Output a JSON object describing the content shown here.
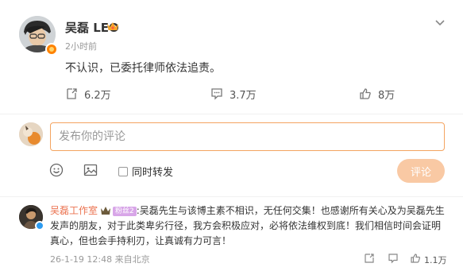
{
  "post": {
    "username": "吴磊 LEO",
    "time": "2小时前",
    "text": "不认识，已委托律师依法追责。",
    "actions": {
      "repost_count": "6.2万",
      "comment_count": "3.7万",
      "like_count": "8万"
    }
  },
  "composer": {
    "placeholder": "发布你的评论",
    "repost_label": "同时转发",
    "submit_label": "评论"
  },
  "comment": {
    "author": "吴磊工作室",
    "level_badge": "粉丝2",
    "text": ":吴磊先生与该博主素不相识，无任何交集！也感谢所有关心及为吴磊先生发声的朋友，对于此类卑劣行径，我方会积极应对，必将依法维权到底！我们相信时间会证明真心，但也会手持利刃，让真诚有力可言！",
    "meta": "26-1-19 12:48 来自北京",
    "like_count": "1.1万"
  },
  "colors": {
    "accent": "#ff8200",
    "link": "#eb7350",
    "input_border": "#f4a460",
    "submit_bg": "#f9c9a4"
  },
  "icons": [
    "crown-icon",
    "chevron-down-icon",
    "repost-icon",
    "comment-icon",
    "like-icon",
    "emoji-icon",
    "image-icon",
    "verified-icon"
  ]
}
